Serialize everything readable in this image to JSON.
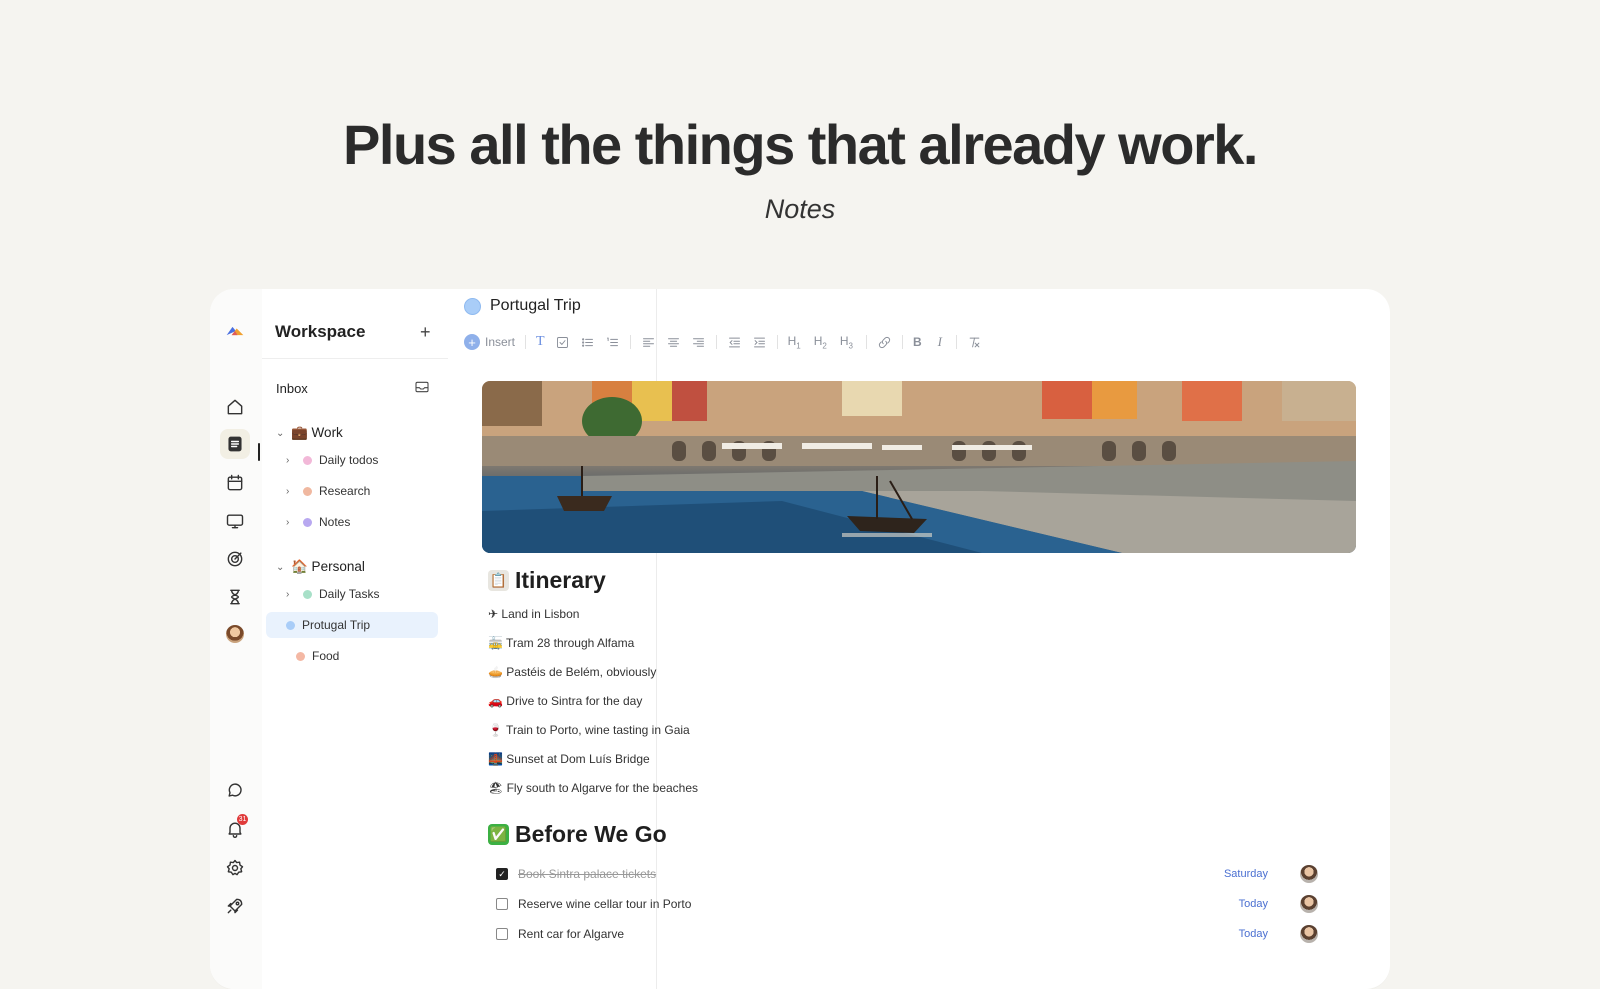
{
  "hero": {
    "title": "Plus all the things that already work.",
    "subtitle": "Notes"
  },
  "rail": {
    "icons": [
      "logo-icon",
      "home-icon",
      "notes-icon",
      "calendar-icon",
      "monitor-icon",
      "goals-icon",
      "hourglass-icon",
      "avatar",
      "chat-icon",
      "bell-icon",
      "settings-icon",
      "rocket-icon"
    ],
    "notification_count": "31"
  },
  "sidebar": {
    "workspace_title": "Workspace",
    "add_label": "+",
    "inbox_label": "Inbox",
    "groups": [
      {
        "label": "💼 Work",
        "items": [
          {
            "label": "Daily todos",
            "color": "#f2b8d8"
          },
          {
            "label": "Research",
            "color": "#f0b8a0"
          },
          {
            "label": "Notes",
            "color": "#b8a8f0"
          }
        ]
      },
      {
        "label": "🏠 Personal",
        "items": [
          {
            "label": "Daily Tasks",
            "color": "#a8e0c8"
          },
          {
            "label": "Protugal Trip",
            "color": "#a9cdf8"
          },
          {
            "label": "Food",
            "color": "#f4b8a4"
          }
        ]
      }
    ]
  },
  "editor": {
    "doc_title": "Portugal Trip",
    "toolbar": {
      "insert_label": "Insert",
      "text_label": "T",
      "bold_label": "B",
      "italic_label": "I",
      "h1_label": "H",
      "h2_label": "H",
      "h3_label": "H",
      "h1_sub": "1",
      "h2_sub": "2",
      "h3_sub": "3"
    },
    "itinerary": {
      "heading_emoji": "📋",
      "heading": "Itinerary",
      "items": [
        "✈ Land in Lisbon",
        "🚋 Tram 28 through Alfama",
        "🥧 Pastéis de Belém, obviously",
        "🚗 Drive to Sintra for the day",
        "🍷 Train to Porto, wine tasting in Gaia",
        "🌉 Sunset at Dom Luís Bridge",
        "🏖 Fly south to Algarve for the beaches"
      ]
    },
    "checklist": {
      "heading_emoji": "✅",
      "heading": "Before We Go",
      "tasks": [
        {
          "label": "Book Sintra palace tickets",
          "done": true,
          "due": "Saturday"
        },
        {
          "label": "Reserve wine cellar tour in Porto",
          "done": false,
          "due": "Today"
        },
        {
          "label": "Rent car for Algarve",
          "done": false,
          "due": "Today"
        }
      ]
    }
  }
}
